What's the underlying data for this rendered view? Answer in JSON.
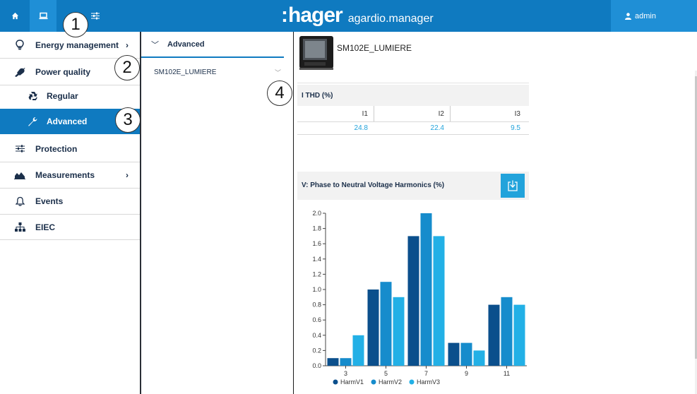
{
  "topbar": {
    "brand_colon": ":",
    "brand_word": "hager",
    "app_name": "agardio.manager",
    "user_label": "admin",
    "icons": [
      "home-icon",
      "monitor-icon",
      "sliders-icon",
      "user-icon"
    ]
  },
  "sidebar": {
    "items": [
      {
        "label": "Energy management",
        "icon": "lightbulb-icon",
        "has_chevron": true
      },
      {
        "label": "Power quality",
        "icon": "plug-icon",
        "has_chevron": false
      },
      {
        "label": "Regular",
        "icon": "recycle-icon",
        "has_chevron": false
      },
      {
        "label": "Advanced",
        "icon": "wrench-icon",
        "has_chevron": false,
        "active": true
      },
      {
        "label": "Protection",
        "icon": "sliders-icon",
        "has_chevron": false
      },
      {
        "label": "Measurements",
        "icon": "area-chart-icon",
        "has_chevron": true
      },
      {
        "label": "Events",
        "icon": "bell-icon",
        "has_chevron": false
      },
      {
        "label": "EIEC",
        "icon": "sitemap-icon",
        "has_chevron": false
      }
    ],
    "chevron": "›"
  },
  "midpanel": {
    "header_chevron": "﹀",
    "header_label": "Advanced",
    "device_select_value": "SM102E_LUMIERE",
    "device_select_caret": "﹀"
  },
  "device": {
    "name": "SM102E_LUMIERE"
  },
  "ithd": {
    "title": "I THD (%)",
    "columns": [
      "I1",
      "I2",
      "I3"
    ],
    "values": [
      "24.8",
      "22.4",
      "9.5"
    ]
  },
  "harmonics_chart": {
    "title": "V: Phase to Neutral Voltage Harmonics (%)"
  },
  "colors": {
    "brand_blue": "#0f7ac0",
    "accent_blue": "#22a3db",
    "series_1": "#0b4f8c",
    "series_2": "#168ccc",
    "series_3": "#22b0e6"
  },
  "callouts": [
    "1",
    "2",
    "3",
    "4"
  ],
  "chart_data": {
    "type": "bar",
    "title": "",
    "xlabel": "",
    "ylabel": "",
    "categories": [
      "3",
      "5",
      "7",
      "9",
      "11"
    ],
    "series": [
      {
        "name": "HarmV1",
        "values": [
          0.1,
          1.0,
          1.7,
          0.3,
          0.8
        ]
      },
      {
        "name": "HarmV2",
        "values": [
          0.1,
          1.1,
          2.0,
          0.3,
          0.9
        ]
      },
      {
        "name": "HarmV3",
        "values": [
          0.4,
          0.9,
          1.7,
          0.2,
          0.8
        ]
      }
    ],
    "ylim": [
      0,
      2.0
    ],
    "yticks": [
      "0.0",
      "0.2",
      "0.4",
      "0.6",
      "0.8",
      "1.0",
      "1.2",
      "1.4",
      "1.6",
      "1.8",
      "2.0"
    ],
    "grid": false,
    "legend": "bottom"
  }
}
